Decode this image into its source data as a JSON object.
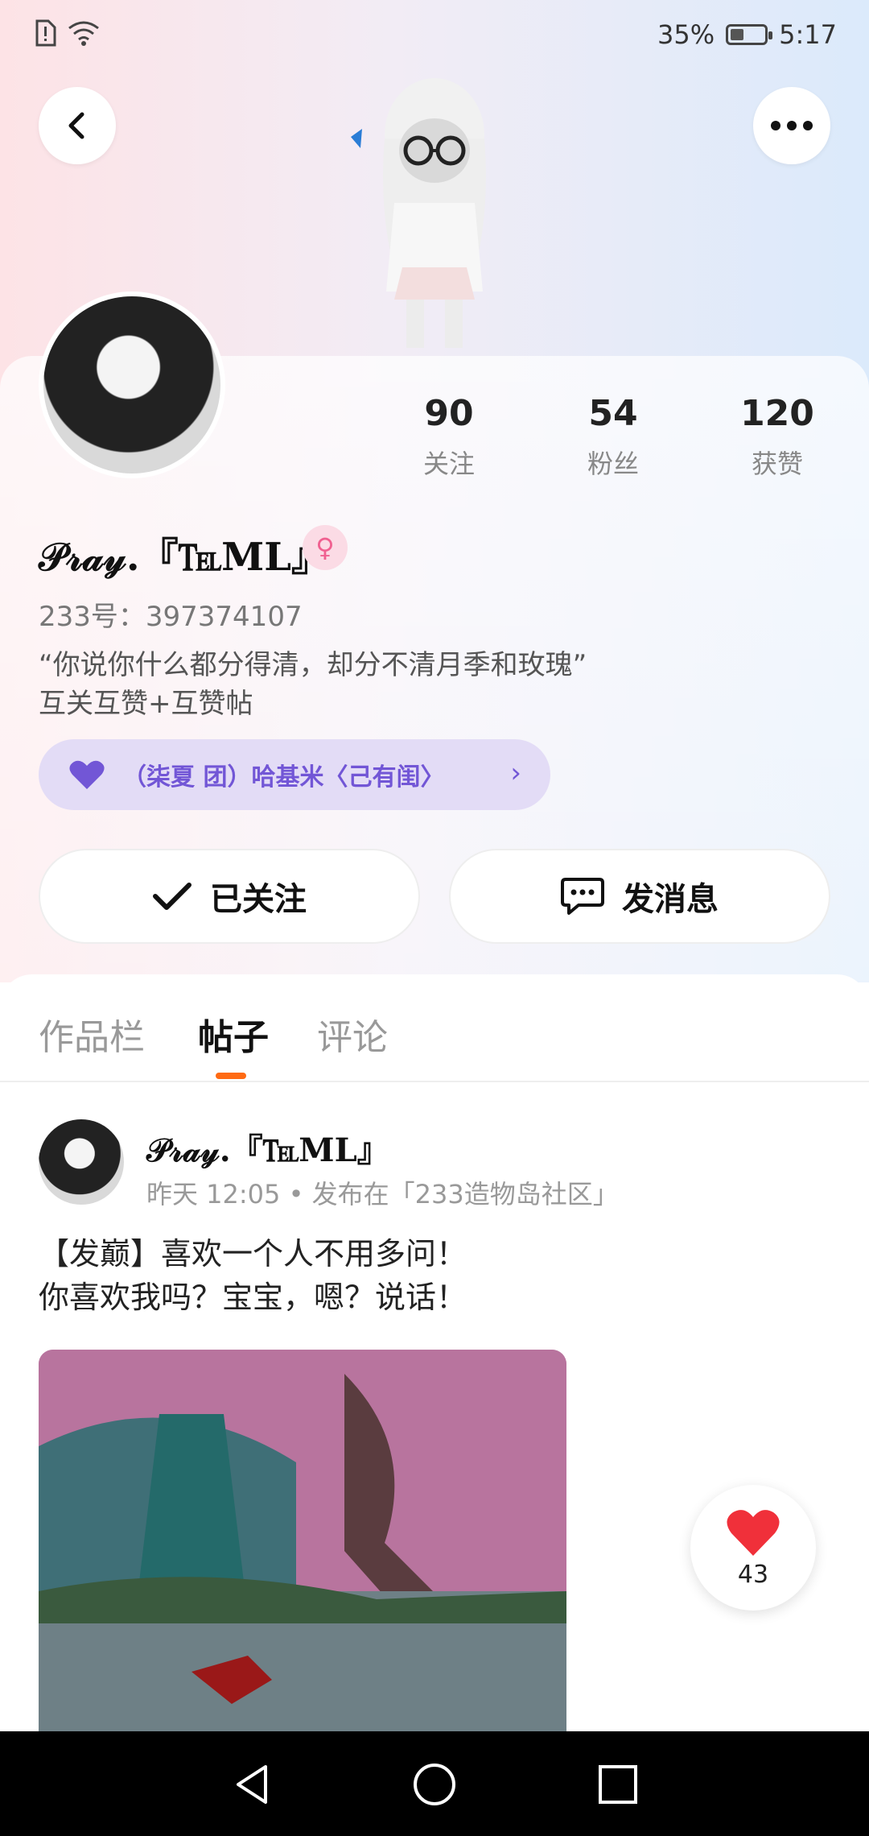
{
  "status_bar": {
    "battery": "35%",
    "time": "5:17"
  },
  "profile": {
    "nickname": "𝒫𝓇𝒶𝓎.『℡ML』",
    "gender_symbol": "♀",
    "uid_label": "233号：397374107",
    "bio": "“你说你什么都分得清，却分不清月季和玫瑰”\n互关互赞+互赞帖",
    "fan_group": "（柒夏 团）哈基米〈己有闺〉",
    "stats": [
      {
        "num": "90",
        "label": "关注"
      },
      {
        "num": "54",
        "label": "粉丝"
      },
      {
        "num": "120",
        "label": "获赞"
      }
    ]
  },
  "actions": {
    "follow": "已关注",
    "message": "发消息"
  },
  "tabs": [
    {
      "label": "作品栏",
      "active": false
    },
    {
      "label": "帖子",
      "active": true
    },
    {
      "label": "评论",
      "active": false
    }
  ],
  "post": {
    "author": "𝒫𝓇𝒶𝓎.『℡ML』",
    "meta": "昨天 12:05 • 发布在「233造物岛社区」",
    "text": "【发巅】喜欢一个人不用多问！\n你喜欢我吗？宝宝，嗯？说话！",
    "likes": "43"
  },
  "colors": {
    "accent": "#ff6a13",
    "fan_purple": "#7256d6",
    "like_red": "#f0303a"
  }
}
